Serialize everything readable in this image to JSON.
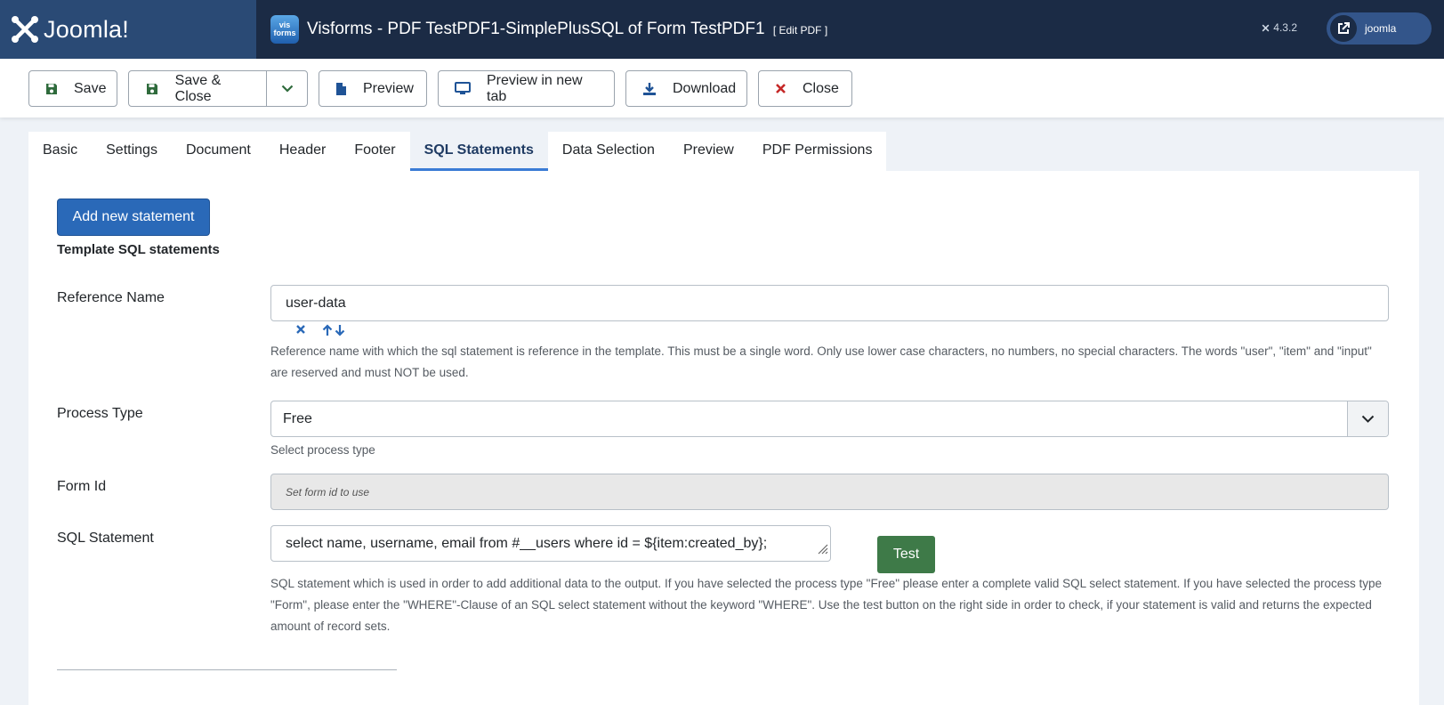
{
  "header": {
    "brand": "Joomla!",
    "app_icon_top": "vis",
    "app_icon_bottom": "forms",
    "title": "Visforms - PDF TestPDF1-SimplePlusSQL of Form TestPDF1",
    "subtitle": "[ Edit PDF ]",
    "version": "4.3.2",
    "user": "joomla"
  },
  "toolbar": {
    "save": "Save",
    "save_close": "Save & Close",
    "preview": "Preview",
    "preview_new_tab": "Preview in new tab",
    "download": "Download",
    "close": "Close"
  },
  "tabs": [
    "Basic",
    "Settings",
    "Document",
    "Header",
    "Footer",
    "SQL Statements",
    "Data Selection",
    "Preview",
    "PDF Permissions"
  ],
  "active_tab": "SQL Statements",
  "form": {
    "add_button": "Add new statement",
    "section_title": "Template SQL statements",
    "reference_name": {
      "label": "Reference Name",
      "value": "user-data",
      "help": "Reference name with which the sql statement is reference in the template. This must be a single word. Only use lower case characters, no numbers, no special characters. The words \"user\", \"item\" and \"input\" are reserved and must NOT be used."
    },
    "process_type": {
      "label": "Process Type",
      "value": "Free",
      "help": "Select process type"
    },
    "form_id": {
      "label": "Form Id",
      "placeholder": "Set form id to use"
    },
    "sql_statement": {
      "label": "SQL Statement",
      "value": "select name, username, email from #__users where id = ${item:created_by};",
      "test_button": "Test",
      "help": "SQL statement which is used in order to add additional data to the output. If you have selected the process type \"Free\" please enter a complete valid SQL select statement. If you have selected the process type \"Form\", please enter the \"WHERE\"-Clause of an SQL select statement without the keyword \"WHERE\". Use the test button on the right side in order to check, if your statement is valid and returns the expected amount of record sets."
    }
  },
  "icons": {
    "save": "floppy-disk-icon",
    "preview": "file-icon",
    "preview_new_tab": "monitor-icon",
    "download": "download-icon",
    "close": "x-icon",
    "delete": "x-icon",
    "move": "arrow-up-down-icon"
  },
  "colors": {
    "header_bg": "#1b2b45",
    "brand_bg": "#2a4a75",
    "primary": "#2a69b8",
    "success": "#3e7a48",
    "danger": "#c52827",
    "save_green": "#2f6b3c",
    "tool_blue": "#1f5396"
  }
}
